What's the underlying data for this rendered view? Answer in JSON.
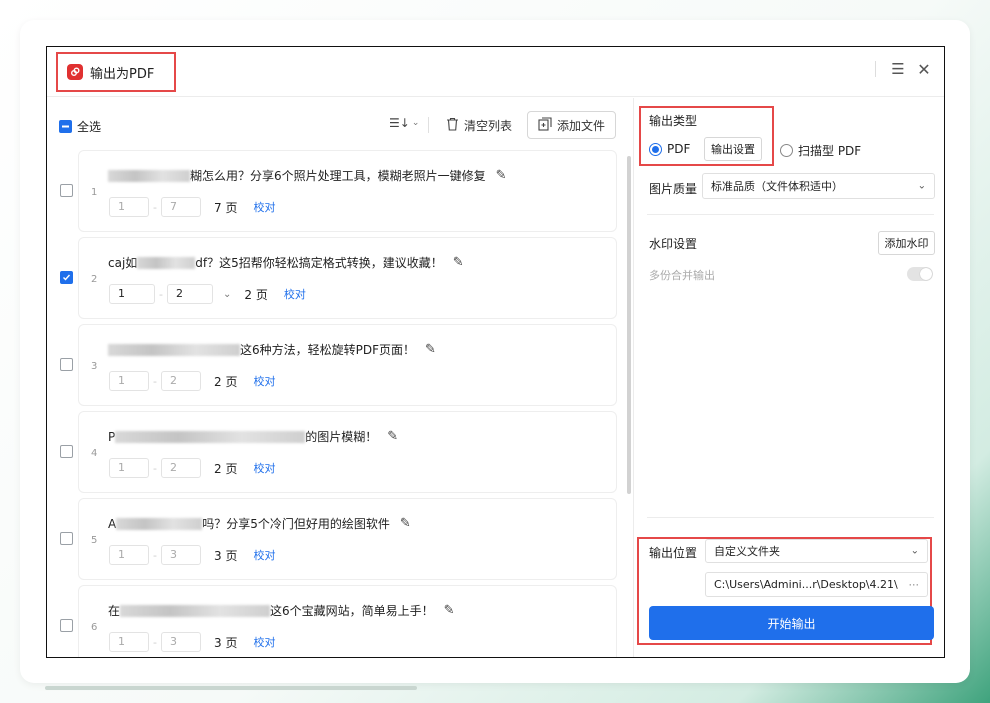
{
  "window": {
    "title": "输出为PDF",
    "menu_icon": "☰",
    "close_icon": "✕"
  },
  "toolbar": {
    "select_all": "全选",
    "sort_icon": "☰↓",
    "clear_list": "清空列表",
    "add_files": "添加文件"
  },
  "files": [
    {
      "index": "1",
      "name_prefix": "",
      "name_suffix": "糊怎么用？分享6个照片处理工具，模糊老照片一键修复",
      "checked": false,
      "from": "1",
      "to": "7",
      "pages": "7 页",
      "check_label": "校对"
    },
    {
      "index": "2",
      "name_prefix": "caj如",
      "name_suffix": "df？这5招帮你轻松搞定格式转换，建议收藏！",
      "checked": true,
      "from": "1",
      "to": "2",
      "pages": "2 页",
      "check_label": "校对"
    },
    {
      "index": "3",
      "name_prefix": "",
      "name_suffix": "这6种方法，轻松旋转PDF页面！",
      "checked": false,
      "from": "1",
      "to": "2",
      "pages": "2 页",
      "check_label": "校对"
    },
    {
      "index": "4",
      "name_prefix": "P",
      "name_suffix": "的图片模糊！",
      "checked": false,
      "from": "1",
      "to": "2",
      "pages": "2 页",
      "check_label": "校对"
    },
    {
      "index": "5",
      "name_prefix": "A",
      "name_suffix": "吗？分享5个冷门但好用的绘图软件",
      "checked": false,
      "from": "1",
      "to": "3",
      "pages": "3 页",
      "check_label": "校对"
    },
    {
      "index": "6",
      "name_prefix": "在",
      "name_suffix": "这6个宝藏网站，简单易上手！",
      "checked": false,
      "from": "1",
      "to": "3",
      "pages": "3 页",
      "check_label": "校对"
    }
  ],
  "settings": {
    "output_type_label": "输出类型",
    "opt_pdf": "PDF",
    "output_settings": "输出设置",
    "opt_scan_pdf": "扫描型 PDF",
    "image_quality_label": "图片质量",
    "image_quality_value": "标准品质（文件体积适中）",
    "watermark_label": "水印设置",
    "add_watermark": "添加水印",
    "merge_output_label": "多份合并输出",
    "output_location_label": "输出位置",
    "output_location_value": "自定义文件夹",
    "output_path": "C:\\Users\\Admini...r\\Desktop\\4.21\\",
    "more_icon": "···",
    "start_button": "开始输出"
  }
}
